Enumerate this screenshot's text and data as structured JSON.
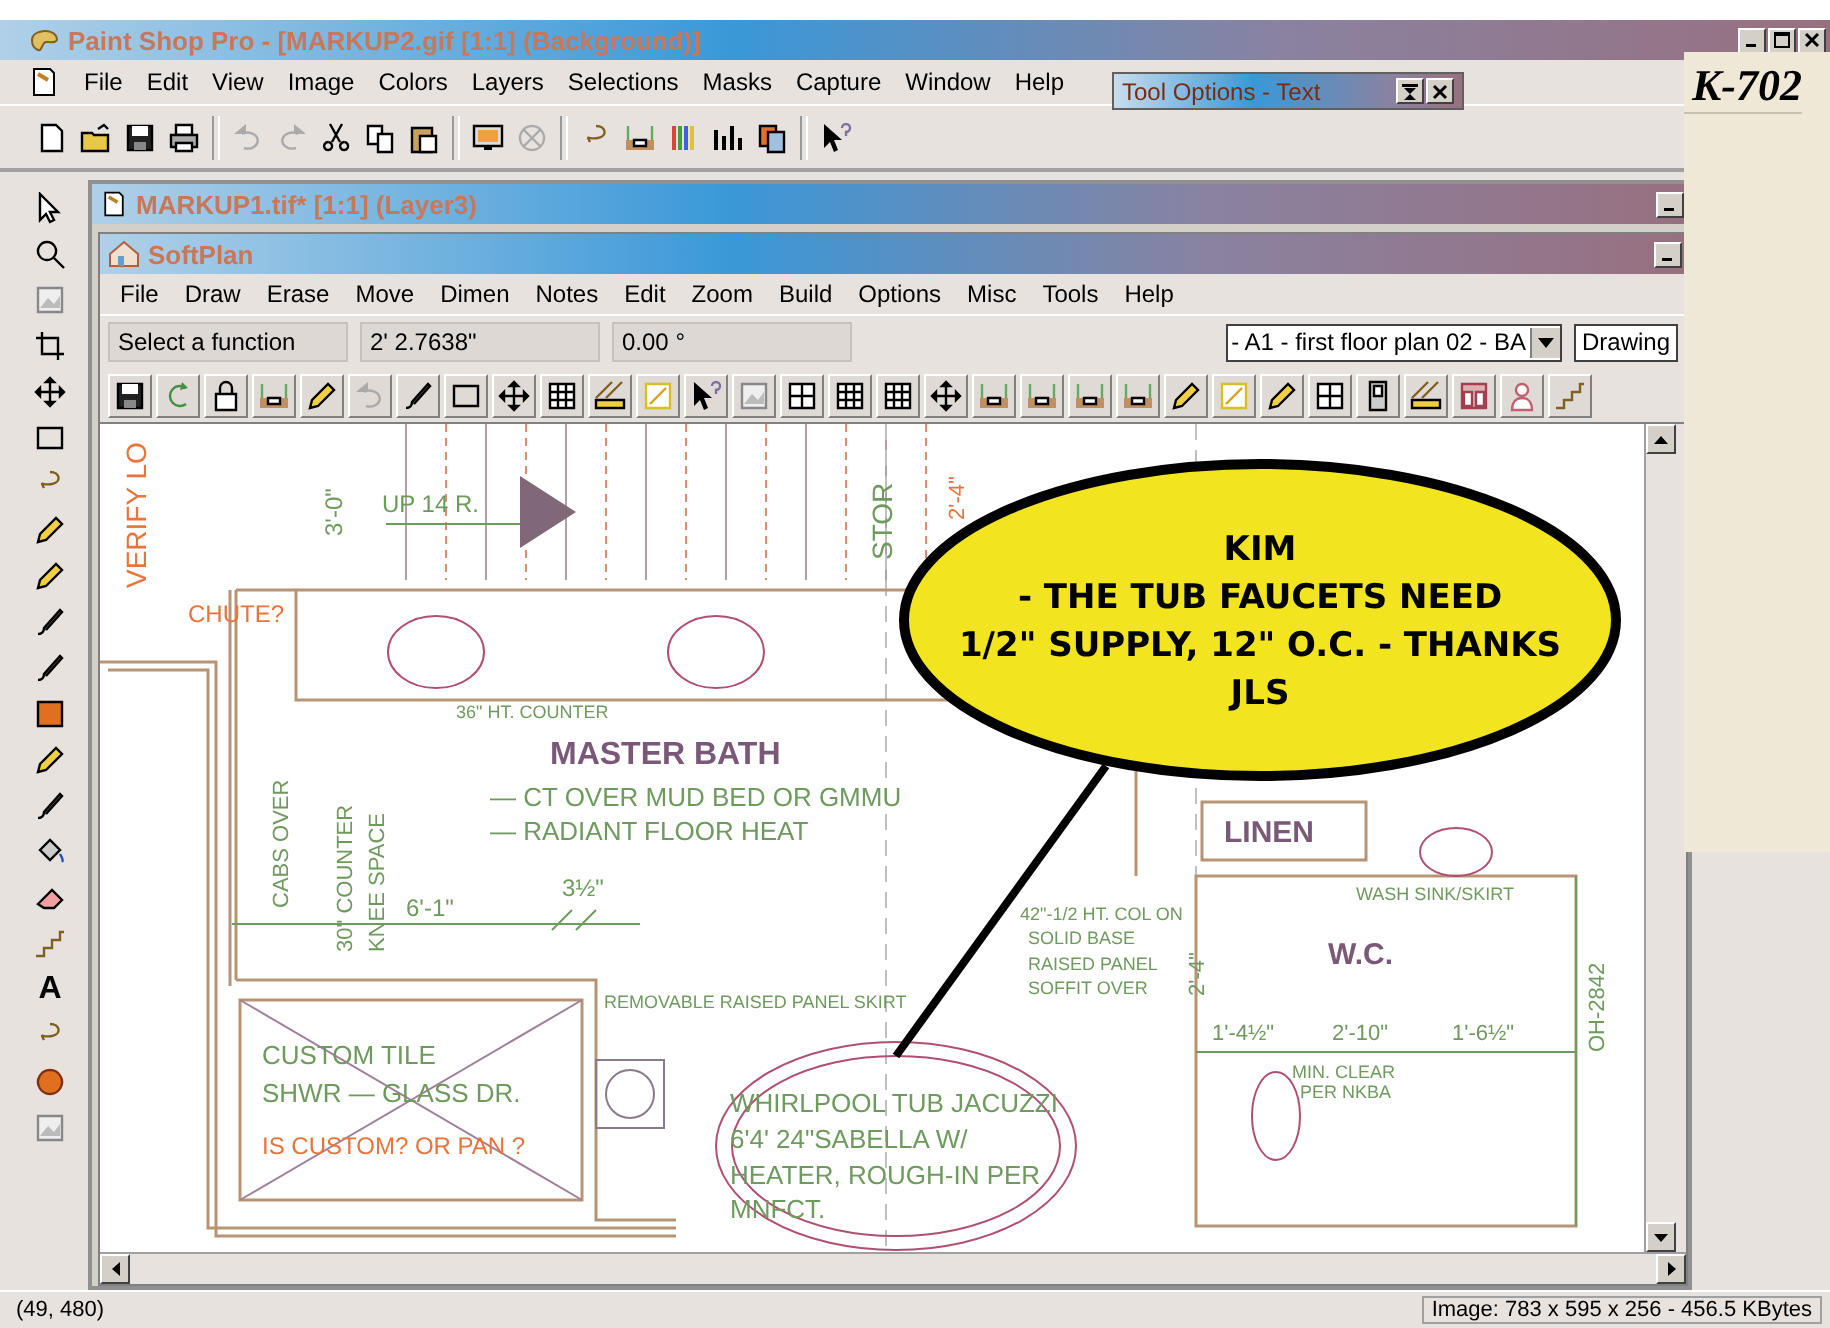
{
  "app": {
    "title": "Paint Shop Pro - [MARKUP2.gif [1:1] (Background)]",
    "menu": [
      "File",
      "Edit",
      "View",
      "Image",
      "Colors",
      "Layers",
      "Selections",
      "Masks",
      "Capture",
      "Window",
      "Help"
    ]
  },
  "tool_options": {
    "title": "Tool Options - Text"
  },
  "tool_palette": {
    "text_tool": "A"
  },
  "document_window": {
    "title": "MARKUP1.tif* [1:1] (Layer3)"
  },
  "softplan": {
    "title": "SoftPlan",
    "menu": [
      "File",
      "Draw",
      "Erase",
      "Move",
      "Dimen",
      "Notes",
      "Edit",
      "Zoom",
      "Build",
      "Options",
      "Misc",
      "Tools",
      "Help"
    ],
    "status_fields": [
      "Select a function",
      "2' 2.7638\"",
      "0.00 °"
    ],
    "plan_dropdown": {
      "value": "- A1 - first floor plan 02 - BA"
    },
    "view_field": {
      "value": "Drawing"
    }
  },
  "drawing": {
    "labels": [
      {
        "text": "VERIFY LO",
        "kind": "note"
      },
      {
        "text": "3'-0\"",
        "kind": "plan"
      },
      {
        "text": "UP 14 R.",
        "kind": "plan"
      },
      {
        "text": "STOR",
        "kind": "plan"
      },
      {
        "text": "2'-4\"",
        "kind": "note"
      },
      {
        "text": "CHUTE?",
        "kind": "note"
      },
      {
        "text": "36\" HT. COUNTER",
        "kind": "plan"
      },
      {
        "text": "MASTER BATH",
        "kind": "room"
      },
      {
        "text": "— CT OVER MUD BED OR GMMU",
        "kind": "plan"
      },
      {
        "text": "— RADIANT FLOOR HEAT",
        "kind": "plan"
      },
      {
        "text": "CABS OVER",
        "kind": "plan"
      },
      {
        "text": "30\" COUNTER",
        "kind": "plan"
      },
      {
        "text": "KNEE SPACE",
        "kind": "plan"
      },
      {
        "text": "6'-1\"",
        "kind": "plan"
      },
      {
        "text": "3½\"",
        "kind": "plan"
      },
      {
        "text": "REMOVABLE RAISED PANEL SKIRT",
        "kind": "plan"
      },
      {
        "text": "CUSTOM TILE",
        "kind": "plan"
      },
      {
        "text": "SHWR — GLASS DR.",
        "kind": "plan"
      },
      {
        "text": "IS CUSTOM? OR PAN ?",
        "kind": "note"
      },
      {
        "text": "WHIRLPOOL TUB JACUZZI",
        "kind": "plan"
      },
      {
        "text": "6'4' 24\"SABELLA  W/",
        "kind": "plan"
      },
      {
        "text": "HEATER, ROUGH-IN PER",
        "kind": "plan"
      },
      {
        "text": "MNFCT.",
        "kind": "plan"
      },
      {
        "text": "42\"-1/2 HT. COL ON",
        "kind": "plan"
      },
      {
        "text": "SOLID BASE",
        "kind": "plan"
      },
      {
        "text": "RAISED PANEL",
        "kind": "plan"
      },
      {
        "text": "SOFFIT OVER",
        "kind": "plan"
      },
      {
        "text": "LINEN",
        "kind": "room"
      },
      {
        "text": "WASH SINK/SKIRT",
        "kind": "plan"
      },
      {
        "text": "W.C.",
        "kind": "room"
      },
      {
        "text": "2'-4\"",
        "kind": "plan"
      },
      {
        "text": "1'-4½\"",
        "kind": "plan"
      },
      {
        "text": "2'-10\"",
        "kind": "plan"
      },
      {
        "text": "1'-6½\"",
        "kind": "plan"
      },
      {
        "text": "MIN. CLEAR",
        "kind": "plan"
      },
      {
        "text": "PER NKBA",
        "kind": "plan"
      },
      {
        "text": "OH-2842",
        "kind": "plan"
      }
    ],
    "callout": [
      "KIM",
      "- THE TUB FAUCETS NEED",
      "1/2\" SUPPLY, 12\" O.C. - THANKS",
      "JLS"
    ]
  },
  "overlay": {
    "text": "K-702"
  },
  "status_bar": {
    "coordinates": "(49, 480)",
    "image_info": "Image:  783 x 595 x 256 - 456.5 KBytes"
  }
}
